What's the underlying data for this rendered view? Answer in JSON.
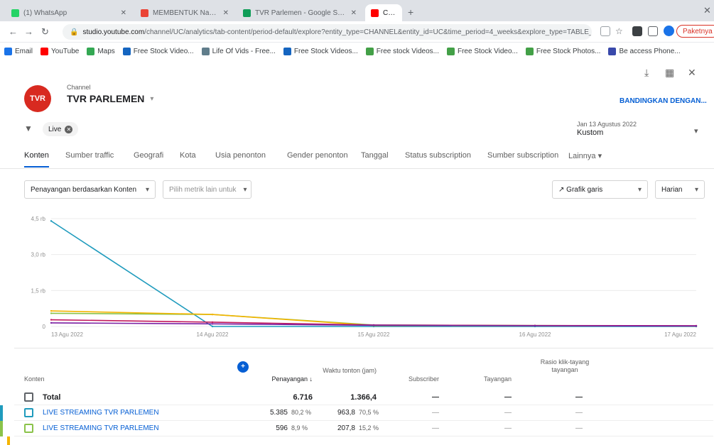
{
  "browser": {
    "tabs": [
      {
        "label": "(1) WhatsApp",
        "fav": "#25d366"
      },
      {
        "label": "MEMBENTUK Naskah Video",
        "fav": "#ea4335"
      },
      {
        "label": "TVR Parlemen - Google Sheet",
        "fav": "#0f9d58"
      },
      {
        "label": "Channel Analytics - YouTube",
        "fav": "#ff0000"
      }
    ],
    "url_host": "studio.youtube.com",
    "url_path": "/channel/UC/analytics/tab-content/period-default/explore?entity_type=CHANNEL&entity_id=UC&time_period=4_weeks&explore_type=TABLE_AND_CHART&metric=VIEWS",
    "update_label": "Paketnya",
    "bookmarks": [
      {
        "label": "Email",
        "color": "#1a73e8"
      },
      {
        "label": "YouTube",
        "color": "#ff0000"
      },
      {
        "label": "Maps",
        "color": "#34a853"
      },
      {
        "label": "Free Stock Video...",
        "color": "#1565c0"
      },
      {
        "label": "Life Of Vids - Free...",
        "color": "#607d8b"
      },
      {
        "label": "Free Stock Videos...",
        "color": "#1565c0"
      },
      {
        "label": "Free stock Videos...",
        "color": "#43a047"
      },
      {
        "label": "Free Stock Video...",
        "color": "#43a047"
      },
      {
        "label": "Free Stock Photos...",
        "color": "#43a047"
      },
      {
        "label": "Be access Phone...",
        "color": "#3949ab"
      }
    ]
  },
  "channel": {
    "label": "Channel",
    "name": "TVR PARLEMEN",
    "avatar_text": "TVR",
    "compare_button": "BANDINGKAN DENGAN..."
  },
  "filter": {
    "chip": "Live",
    "date_label": "Jan 13 Agustus 2022",
    "date_value": "Kustom"
  },
  "report_tabs": [
    "Konten",
    "Sumber traffic",
    "Geografi",
    "Kota",
    "Usia penonton",
    "Gender penonton",
    "Tanggal",
    "Status subscription",
    "Sumber subscription",
    "Lainnya"
  ],
  "dropdowns": {
    "metric": "Penayangan berdasarkan Konten",
    "compare": "Pilih metrik lain untuk",
    "chart_type": "Grafik garis",
    "interval": "Harian"
  },
  "chart_data": {
    "type": "line",
    "y_ticks": [
      "0",
      "1,5 rb",
      "3,0 rb",
      "4,5 rb"
    ],
    "ylim": [
      0,
      4500
    ],
    "x_labels": [
      "13 Agu 2022",
      "14 Agu 2022",
      "15 Agu 2022",
      "16 Agu 2022",
      "17 Agu 2022"
    ],
    "colors": {
      "s1": "#1f9bbd",
      "s2": "#8bc34a",
      "s3": "#f4b400",
      "s4": "#c2185b",
      "s5": "#7b1fa2"
    },
    "series": [
      {
        "key": "s1",
        "values": [
          4400,
          0,
          0,
          0,
          0
        ]
      },
      {
        "key": "s2",
        "values": [
          550,
          500,
          60,
          40,
          20
        ]
      },
      {
        "key": "s3",
        "values": [
          650,
          500,
          40,
          30,
          20
        ]
      },
      {
        "key": "s4",
        "values": [
          280,
          180,
          60,
          40,
          30
        ]
      },
      {
        "key": "s5",
        "values": [
          150,
          110,
          50,
          30,
          20
        ]
      }
    ]
  },
  "table": {
    "headers": {
      "video": "Konten",
      "views": "Penayangan ↓",
      "watch_time": "Waktu tonton (jam)",
      "subscribers": "Subscriber",
      "revenue": "Tayangan",
      "impressions": "Rasio klik-tayang tayangan"
    },
    "total": {
      "label": "Total",
      "views": "6.716",
      "watch_time": "1.366,4",
      "subscribers": "—",
      "revenue": "—",
      "impressions": "—"
    },
    "rows": [
      {
        "name": "LIVE STREAMING TVR PARLEMEN",
        "views": "5.385",
        "views_pct": "80,2 %",
        "watch_time": "963,8",
        "watch_pct": "70,5 %",
        "subscribers": "—",
        "revenue": "—",
        "impressions": "—",
        "color": "#1f9bbd"
      },
      {
        "name": "LIVE STREAMING TVR PARLEMEN",
        "views": "596",
        "views_pct": "8,9 %",
        "watch_time": "207,8",
        "watch_pct": "15,2 %",
        "subscribers": "—",
        "revenue": "—",
        "impressions": "—",
        "color": "#8bc34a"
      }
    ]
  }
}
